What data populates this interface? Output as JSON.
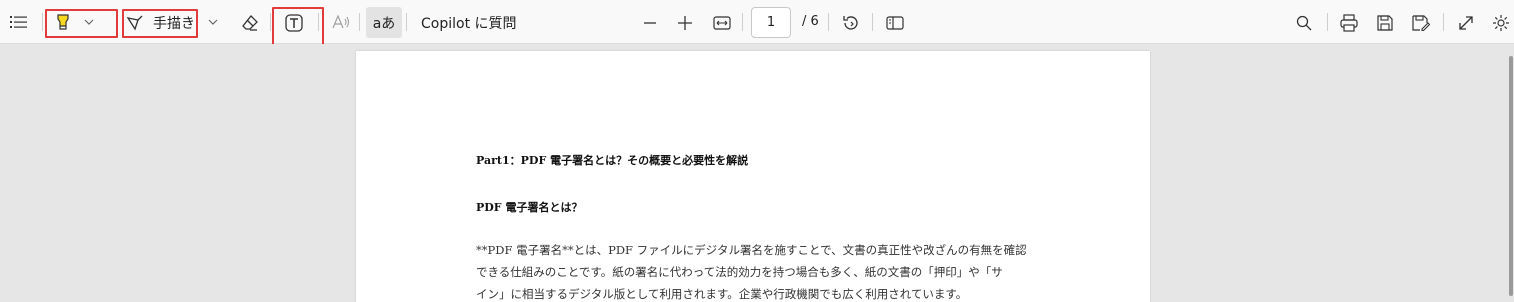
{
  "toolbar": {
    "draw_label": "手描き",
    "copilot_label": "Copilot に質問",
    "page_current": "1",
    "page_total": "/ 6",
    "icons": [
      "contents-icon",
      "highlight-icon",
      "chevron-down-icon",
      "pen-icon",
      "eraser-icon",
      "text-box-icon",
      "read-aloud-icon",
      "translate-icon",
      "zoom-out-icon",
      "zoom-in-icon",
      "fit-width-icon",
      "rotate-icon",
      "page-view-icon",
      "search-icon",
      "print-icon",
      "save-icon",
      "save-as-icon",
      "fullscreen-icon",
      "settings-icon"
    ],
    "translate_label": "aあ",
    "highlight_color": "#f5d81f",
    "annotation_box_color": "#e23b3b"
  },
  "document": {
    "heading1": "Part1：PDF 電子署名とは？その概要と必要性を解説",
    "heading2": "PDF 電子署名とは？",
    "para_lines": [
      "**PDF 電子署名**とは、PDF ファイルにデジタル署名を施すことで、文書の真正性や改ざんの有無を確認",
      "できる仕組みのことです。紙の署名に代わって法的効力を持つ場合も多く、紙の文書の「押印」や「サ",
      "イン」に相当するデジタル版として利用されます。企業や行政機関でも広く利用されています。"
    ]
  }
}
